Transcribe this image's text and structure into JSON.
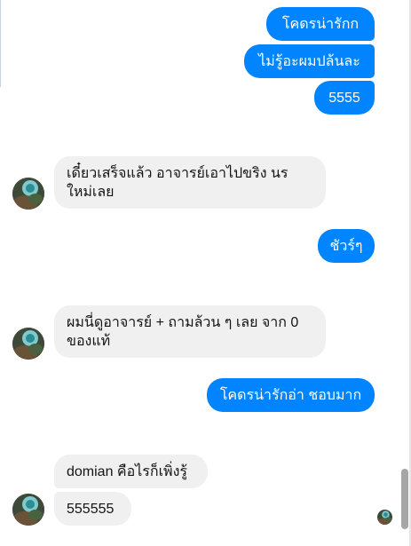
{
  "messages": {
    "m1": "โคดรน่ารักก",
    "m2": "ไม่รู้อะผมปล้นละ",
    "m3": "5555",
    "m4": "เดี๋ยวเสร็จแล้ว อาจารย์เอาไปขริง นร ใหม่เลย",
    "m5": "ชัวร์ๆ",
    "m6": "ผมนี่ดูอาจารย์ + ถามล้วน ๆ เลย จาก 0 ของแท้",
    "m7": "โคดรน่ารักอ่า ชอบมาก",
    "m8": "domian คือไรก็เพิ่งรู้",
    "m9": "555555"
  },
  "colors": {
    "outgoing_bubble": "#0084ff",
    "incoming_bubble": "#f0f0f0"
  },
  "icons": {
    "avatar": "user-avatar-icon",
    "seen": "seen-avatar-icon"
  }
}
